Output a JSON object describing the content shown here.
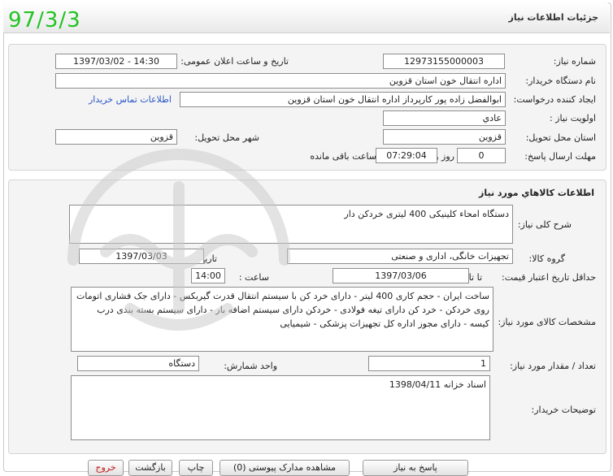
{
  "header": {
    "title": "جزئیات اطلاعات نیاز",
    "date_stamp": "97/3/3"
  },
  "info": {
    "need_number_label": "شماره نیاز:",
    "need_number": "12973155000003",
    "announce_label": "تاریخ و ساعت اعلان عمومی:",
    "announce_value": "1397/03/02 - 14:30",
    "buyer_org_label": "نام دستگاه خریدار:",
    "buyer_org": "اداره انتقال خون استان قزوین",
    "requester_label": "ایجاد کننده درخواست:",
    "requester": "ابوالفضل زاده پور کارپرداز اداره انتقال خون استان قزوین",
    "contact_link": "اطلاعات تماس خریدار",
    "priority_label": "اولویت نیاز :",
    "priority": "عادي",
    "province_label": "استان محل تحویل:",
    "province": "قزوین",
    "city_label": "شهر محل تحویل:",
    "city": "قزوین",
    "deadline_label": "مهلت ارسال پاسخ:",
    "days": "0",
    "days_unit": "روز و",
    "time_left": "07:29:04",
    "time_left_unit": "ساعت باقی مانده"
  },
  "goods": {
    "section_title": "اطلاعات کالاهاي مورد نیاز",
    "summary_label": "شرح کلی نیاز:",
    "summary": "دستگاه امحاء کلینیکی 400 لیتری خردکن دار",
    "group_label": "گروه کالا:",
    "group": "تجهیزات خانگی، اداری و صنعتی",
    "need_date_label": "تاریخ نیاز به کالا:",
    "need_date": "1397/03/03",
    "validity_label": "حداقل تاریخ اعتبار قیمت:",
    "until_label": "تا تاریخ :",
    "until_date": "1397/03/06",
    "hour_label": "ساعت :",
    "hour": "14:00",
    "specs_label": "مشخصات کالای مورد نیاز:",
    "specs": "ساخت ایران - حجم کاری 400 لیتر - دارای خرد کن با سیستم انتقال قدرت گیربکس  - دارای جک فشاری اتومات روی خردکن - خرد کن دارای تیغه فولادی - خردکن دارای سیستم اضافه بار - دارای سیستم بسته بندی درب کیسه - دارای مجوز اداره کل تجهیزات پزشکی - شیمیایی",
    "qty_label": "تعداد / مقدار مورد نیاز:",
    "qty": "1",
    "unit_label": "واحد شمارش:",
    "unit": "دستگاه",
    "buyer_notes_label": "توضیحات خریدار:",
    "buyer_notes": "اسناد خزانه 1398/04/11"
  },
  "actions": {
    "reply": "پاسخ به نیاز",
    "attachments": "مشاهده مدارک پیوستی (0)",
    "print": "چاپ",
    "back": "بازگشت",
    "exit": "خروج"
  }
}
